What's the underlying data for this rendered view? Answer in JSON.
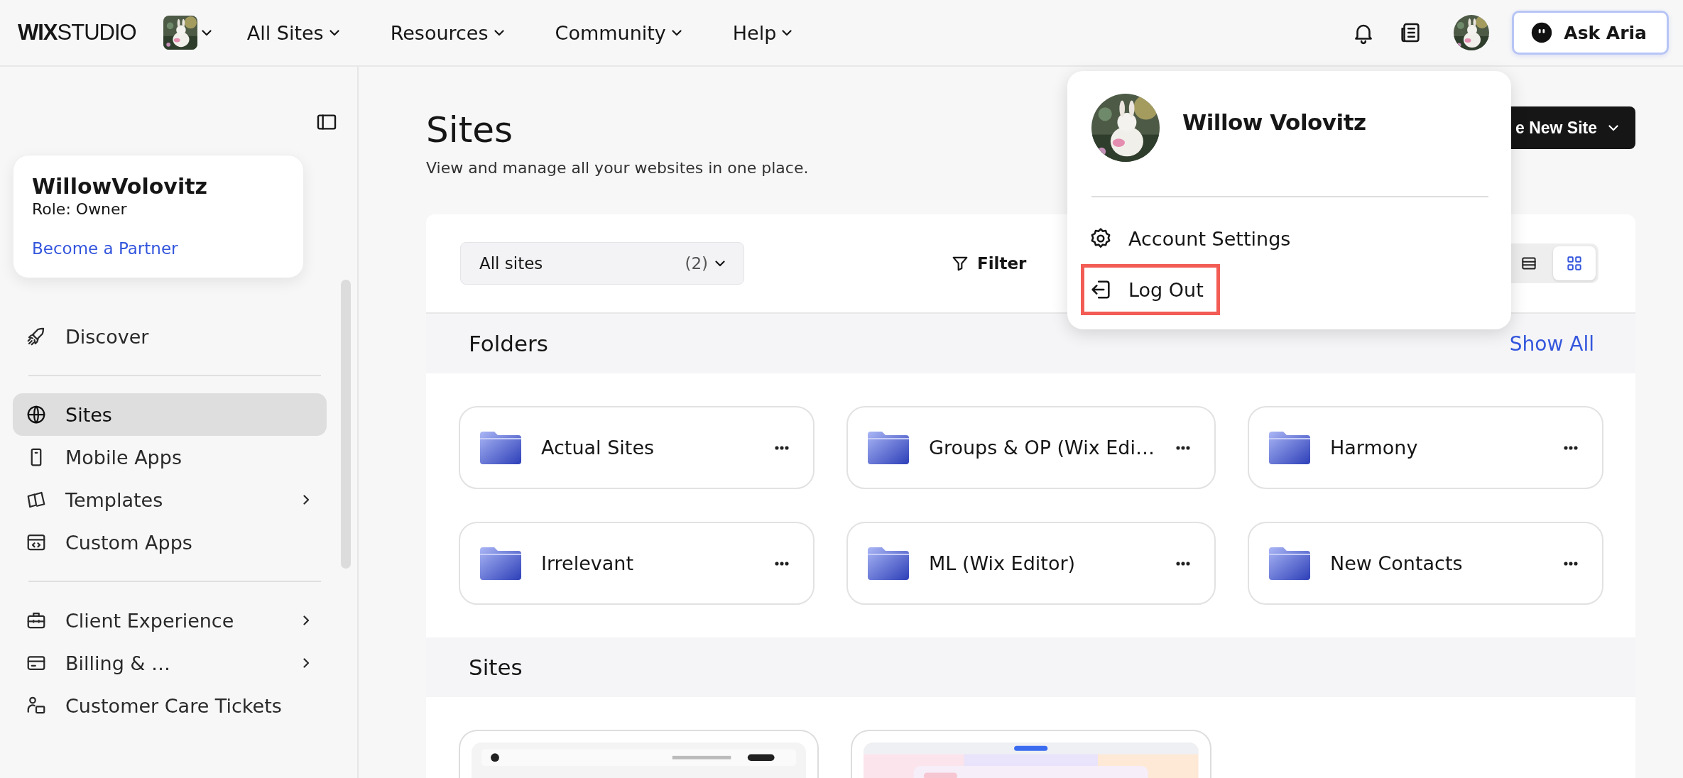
{
  "top_bar": {
    "logo_bold": "WIX",
    "logo_light": "STUDIO",
    "nav": [
      {
        "label": "All Sites"
      },
      {
        "label": "Resources"
      },
      {
        "label": "Community"
      },
      {
        "label": "Help"
      }
    ],
    "ask_button": "Ask Aria"
  },
  "sidebar": {
    "account": {
      "name": "WillowVolovitz",
      "role": "Role: Owner",
      "link": "Become a Partner"
    },
    "groups": [
      [
        {
          "label": "Discover",
          "selected": false,
          "submenu": false
        }
      ],
      [
        {
          "label": "Sites",
          "selected": true,
          "submenu": false
        },
        {
          "label": "Mobile Apps",
          "selected": false,
          "submenu": false
        },
        {
          "label": "Templates",
          "selected": false,
          "submenu": true
        },
        {
          "label": "Custom Apps",
          "selected": false,
          "submenu": false
        }
      ],
      [
        {
          "label": "Client Experience",
          "selected": false,
          "submenu": true
        },
        {
          "label": "Billing & …",
          "selected": false,
          "submenu": true
        },
        {
          "label": "Customer Care Tickets",
          "selected": false,
          "submenu": false
        }
      ]
    ]
  },
  "main": {
    "title": "Sites",
    "subtitle": "View and manage all your websites in one place.",
    "create_button": "e New Site",
    "filter_bar": {
      "select": "All sites",
      "count": "(2)",
      "filter": "Filter",
      "views": [
        {
          "kind": "list",
          "selected": false
        },
        {
          "kind": "grid",
          "selected": true
        }
      ]
    },
    "folders": {
      "title": "Folders",
      "action": "Show All",
      "items": [
        {
          "name": "Actual Sites"
        },
        {
          "name": "Groups & OP (Wix Edi…"
        },
        {
          "name": "Harmony"
        },
        {
          "name": "Irrelevant"
        },
        {
          "name": "ML (Wix Editor)"
        },
        {
          "name": "New Contacts"
        }
      ]
    },
    "sites": {
      "title": "Sites"
    }
  },
  "account_menu": {
    "name": "Willow Volovitz",
    "items": [
      {
        "kind": "settings",
        "label": "Account Settings",
        "highlighted": false
      },
      {
        "kind": "logout",
        "label": "Log Out",
        "highlighted": true
      }
    ]
  }
}
